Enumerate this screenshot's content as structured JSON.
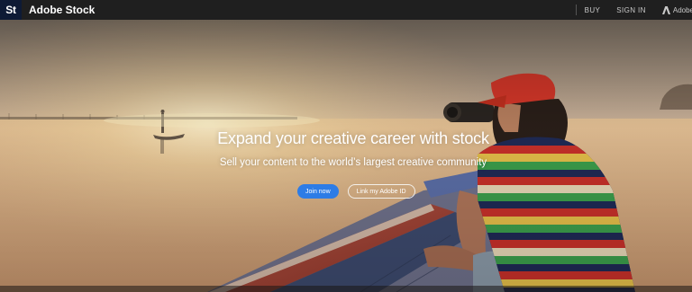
{
  "header": {
    "logo_text": "St",
    "brand": "Adobe Stock",
    "nav": {
      "buy": "BUY",
      "sign_in": "SIGN IN",
      "adobe": "Adobe"
    }
  },
  "hero": {
    "headline": "Expand your creative career with stock",
    "subheadline": "Sell your content to the world’s largest creative community",
    "primary_cta": "Join now",
    "secondary_cta": "Link my Adobe ID"
  },
  "colors": {
    "nav_background": "#1f1f1f",
    "logo_background": "#0e1a35",
    "primary_button": "#2d7ce6",
    "hat_red": "#d9382a"
  },
  "icons": {
    "adobe": "adobe-logo-icon"
  }
}
